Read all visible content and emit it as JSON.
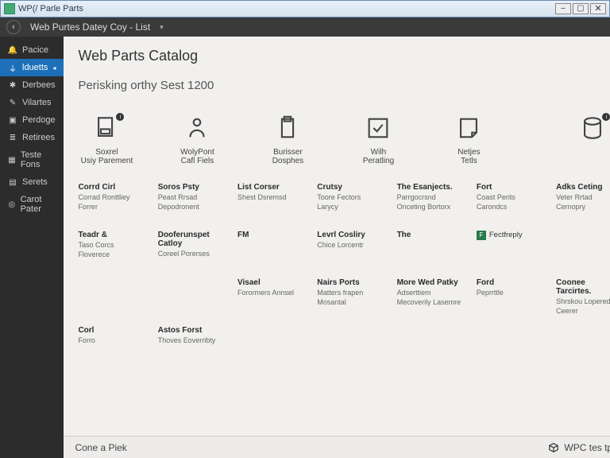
{
  "window": {
    "title": "WP(/ Parle Parts"
  },
  "ribbon": {
    "breadcrumb": "Web Purtes Datey Coy - List"
  },
  "sidebar": {
    "items": [
      {
        "label": "Pacice",
        "icon": "bell",
        "active": false
      },
      {
        "label": "lduetts",
        "icon": "plug",
        "active": true
      },
      {
        "label": "Derbees",
        "icon": "gear",
        "active": false
      },
      {
        "label": "Vilartes",
        "icon": "wand",
        "active": false
      },
      {
        "label": "Perdoge",
        "icon": "box",
        "active": false
      },
      {
        "label": "Retirees",
        "icon": "list",
        "active": false
      },
      {
        "label": "Teste Fons",
        "icon": "grid",
        "active": false
      },
      {
        "label": "Serets",
        "icon": "sheet",
        "active": false
      },
      {
        "label": "Carot Pater",
        "icon": "target",
        "active": false
      }
    ]
  },
  "page": {
    "title": "Web Parts Catalog",
    "subtitle": "Perisking orthy Sest 1200"
  },
  "iconrow": [
    {
      "name": "document-icon",
      "label1": "Soxrel",
      "label2": "Usiy Parement",
      "badge": "i"
    },
    {
      "name": "person-icon",
      "label1": "WolyPont",
      "label2": "Cafl Fiels"
    },
    {
      "name": "clipboard-icon",
      "label1": "Burisser",
      "label2": "Dosphes"
    },
    {
      "name": "check-icon",
      "label1": "Wilh",
      "label2": "Peratling"
    },
    {
      "name": "note-icon",
      "label1": "Netjes",
      "label2": "Tetls"
    },
    {
      "name": "database-icon",
      "label1": "",
      "label2": "",
      "badge": "i"
    }
  ],
  "grid": [
    [
      {
        "hd": "Corrd Cirl",
        "ln": "Corrad Ronttliey Forrer"
      },
      {
        "hd": "Soros Psty",
        "ln": "Peast Rrsad Depodronent"
      },
      {
        "hd": "List Corser",
        "ln": "Shest Dsremsd"
      },
      {
        "hd": "Crutsy",
        "ln": "Toore Fectors Larycy"
      },
      {
        "hd": "The Esanjects.",
        "ln": "Parrgocrsnd Onceting Bortorx"
      },
      {
        "hd": "Fort",
        "ln": "Coast Perits Carondcs"
      },
      {
        "hd": "Adks Ceting",
        "ln": "Veter Rrtad Cernopry"
      },
      {
        "hd": "Teadr &",
        "ln": "Taso Corcs Floverece"
      }
    ],
    [
      {
        "hd": "Dooferunspet Catloy",
        "ln": "Coreel Porerses"
      },
      {
        "hd": "FM",
        "ln": ""
      },
      {
        "hd": "Levrl Cosliry",
        "ln": "Chice Lorcentr"
      },
      {
        "hd": "The",
        "ln": ""
      },
      {
        "hd": "",
        "ln": "",
        "flag": "F",
        "flagtxt": "Fectfreply"
      },
      {
        "hd": "",
        "ln": ""
      },
      {
        "hd": "",
        "ln": ""
      },
      {
        "hd": "",
        "ln": ""
      }
    ],
    [
      {
        "hd": "Visael",
        "ln": "Forormers Annsel"
      },
      {
        "hd": "Nairs Ports",
        "ln": "Matters frapen Mosantal"
      },
      {
        "hd": "More Wed Patky",
        "ln": "Adserttiem Mecoverily Lasemre"
      },
      {
        "hd": "Ford",
        "ln": "Peprrttle"
      },
      {
        "hd": "Coonee Tarcirtes.",
        "ln": "Shrskou Loperedy Ceerer"
      },
      {
        "hd": "Corl",
        "ln": "Forro"
      },
      {
        "hd": "Astos Forst",
        "ln": "Thoves Eoverribty"
      },
      {
        "hd": "",
        "ln": ""
      }
    ]
  ],
  "footer": {
    "left": "Cone a Piek",
    "brand": "WPC tes tplay"
  }
}
